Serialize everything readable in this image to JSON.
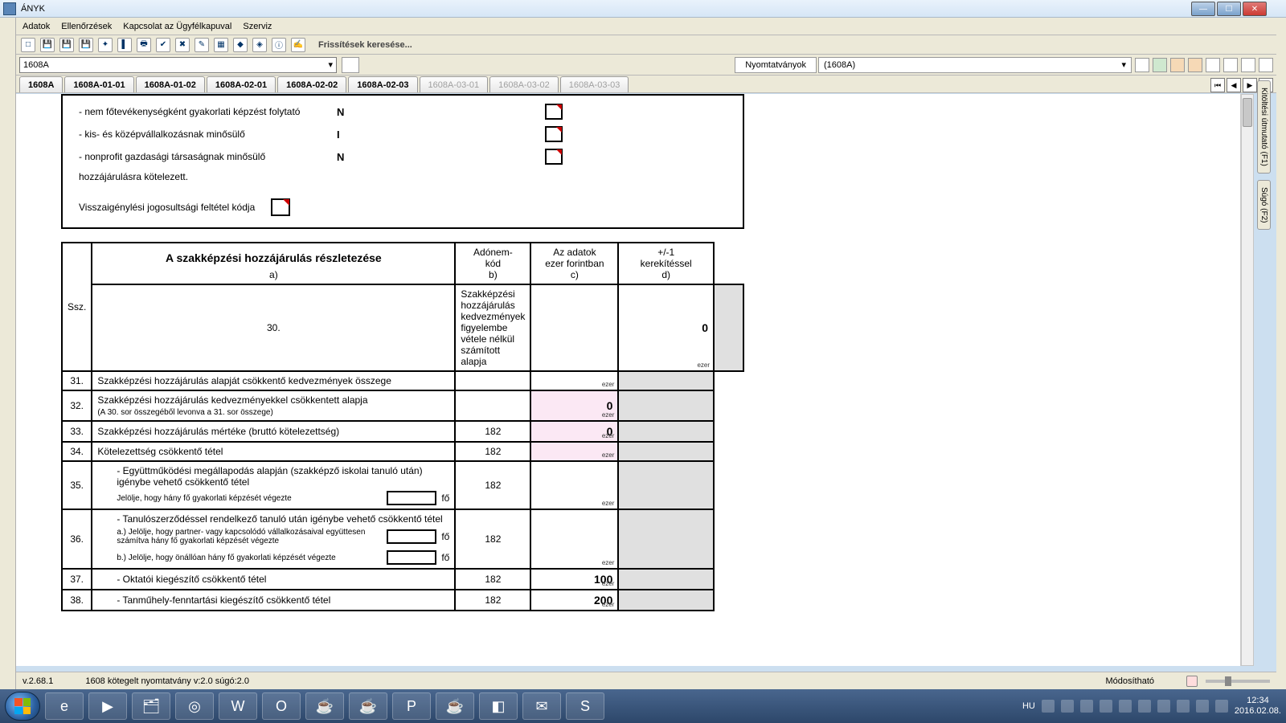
{
  "window": {
    "title": "ÁNYK"
  },
  "menubar": [
    "Adatok",
    "Ellenőrzések",
    "Kapcsolat az Ügyfélkapuval",
    "Szerviz"
  ],
  "toolbar_message": "Frissítések keresése...",
  "form_selector": {
    "value": "1608A"
  },
  "print_label": "Nyomtatványok",
  "print_code": "(1608A)",
  "tabs": [
    {
      "label": "1608A",
      "enabled": true
    },
    {
      "label": "1608A-01-01",
      "enabled": true
    },
    {
      "label": "1608A-01-02",
      "enabled": true
    },
    {
      "label": "1608A-02-01",
      "enabled": true
    },
    {
      "label": "1608A-02-02",
      "enabled": true
    },
    {
      "label": "1608A-02-03",
      "enabled": true
    },
    {
      "label": "1608A-03-01",
      "enabled": false
    },
    {
      "label": "1608A-03-02",
      "enabled": false
    },
    {
      "label": "1608A-03-03",
      "enabled": false
    }
  ],
  "side_tabs": [
    "Kitöltési útmutató (F1)",
    "Súgó (F2)"
  ],
  "options": {
    "row1": "- nem főtevékenységként gyakorlati képzést folytató",
    "row1_val": "N",
    "row2": "- kis- és középvállalkozásnak minősülő",
    "row2_val": "I",
    "row3": "- nonprofit gazdasági társaságnak minősülő",
    "row3_val": "N",
    "footer": "hozzájárulásra kötelezett.",
    "vissz_label": "Visszaigénylési jogosultsági feltétel kódja"
  },
  "table": {
    "title": "A szakképzési hozzájárulás részletezése",
    "hdr_ssz": "Ssz.",
    "hdr_adonem_l1": "Adónem-",
    "hdr_adonem_l2": "kód",
    "hdr_adat_l1": "Az adatok",
    "hdr_adat_l2": "ezer forintban",
    "hdr_ker_l1": "+/-1",
    "hdr_ker_l2": "kerekítéssel",
    "col_a": "a)",
    "col_b": "b)",
    "col_c": "c)",
    "col_d": "d)",
    "rows": [
      {
        "n": "30.",
        "desc": "Szakképzési hozzájárulás kedvezmények figyelembe vétele nélkül számított alapja",
        "adonem": "",
        "val": "0"
      },
      {
        "n": "31.",
        "desc": "Szakképzési hozzájárulás alapját csökkentő kedvezmények összege",
        "adonem": "",
        "val": ""
      },
      {
        "n": "32.",
        "desc": "Szakképzési hozzájárulás kedvezményekkel csökkentett alapja",
        "sub": "(A 30. sor összegéből levonva a 31. sor összege)",
        "adonem": "",
        "val": "0",
        "pink": true
      },
      {
        "n": "33.",
        "desc": "Szakképzési hozzájárulás mértéke (bruttó kötelezettség)",
        "adonem": "182",
        "val": "0",
        "pink": true
      },
      {
        "n": "34.",
        "desc": "Kötelezettség csökkentő tétel",
        "adonem": "182",
        "val": "",
        "pink": true
      }
    ],
    "row35": {
      "n": "35.",
      "desc": "- Együttműködési megállapodás alapján (szakképző iskolai tanuló után) igénybe vehető csökkentő tétel",
      "jel": "Jelölje, hogy hány fő gyakorlati képzését végezte",
      "fo": "fő",
      "adonem": "182"
    },
    "row36": {
      "n": "36.",
      "desc": "- Tanulószerződéssel rendelkező tanuló után igénybe vehető csökkentő tétel",
      "a": "a.) Jelölje, hogy partner- vagy kapcsolódó vállalkozásaival együttesen számítva hány fő gyakorlati képzését végezte",
      "b": "b.) Jelölje, hogy önállóan hány fő gyakorlati képzését végezte",
      "fo": "fő",
      "adonem": "182"
    },
    "row37": {
      "n": "37.",
      "desc": "- Oktatói kiegészítő csökkentő tétel",
      "adonem": "182",
      "val": "100"
    },
    "row38": {
      "n": "38.",
      "desc": "- Tanműhely-fenntartási kiegészítő csökkentő tétel",
      "adonem": "182",
      "val": "200"
    }
  },
  "statusbar": {
    "version": "v.2.68.1",
    "form_version": "1608 kötegelt nyomtatvány v:2.0 súgó:2.0",
    "editable": "Módosítható"
  },
  "tray": {
    "lang": "HU",
    "time": "12:34",
    "date": "2016.02.08."
  },
  "ezer_label": "ezer"
}
